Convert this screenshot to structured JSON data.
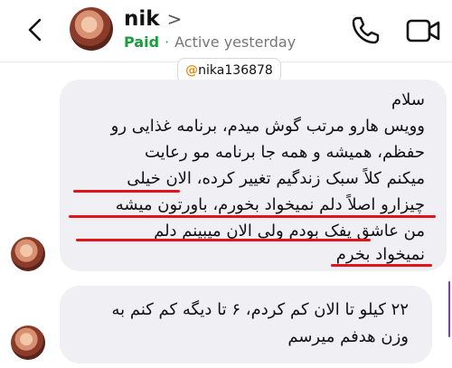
{
  "header": {
    "contact_name": "nik",
    "name_chevron": ">",
    "badge": "Paid",
    "separator": "·",
    "status": "Active yesterday"
  },
  "chat": {
    "username_tag": "nika136878",
    "messages": [
      {
        "lines": [
          "سلام",
          "وویس هارو مرتب گوش میدم، برنامه غذایی رو",
          "حفظم، همیشه و همه جا برنامه مو رعایت",
          "میکنم کلاً سبک زندگیم تغییر کرده، الان خیلی",
          "چیزارو اصلاً دلم نمیخواد بخورم، باورتون میشه",
          "من عاشق پفک بودم ولی الان میبینم دلم",
          "نمیخواد بخرم"
        ]
      },
      {
        "lines": [
          "۲۲ کیلو تا الان کم کردم، ۶ تا دیگه کم کنم به",
          "وزن هدفم میرسم"
        ]
      }
    ]
  },
  "colors": {
    "paid_green": "#1a9e3d",
    "underline_red": "#e0141a",
    "bubble_gray": "#efeff4",
    "scroll_accent": "#7b3fb2"
  },
  "icons": [
    "back-chevron-icon",
    "phone-icon",
    "video-camera-icon",
    "instagram-icon"
  ]
}
